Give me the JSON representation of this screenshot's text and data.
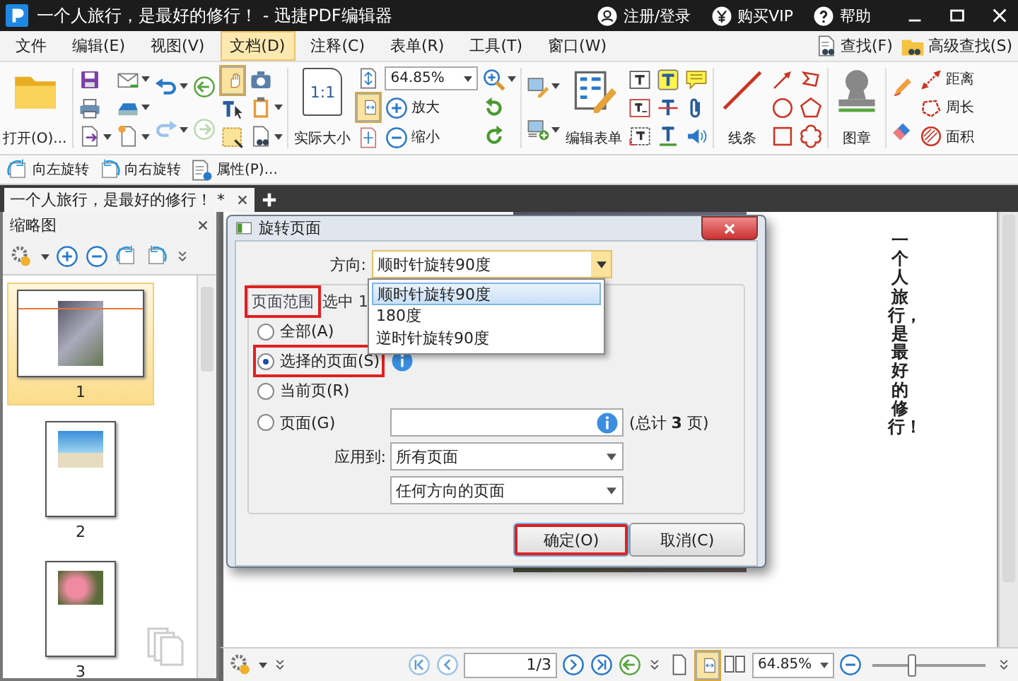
{
  "window": {
    "title": "一个人旅行，是最好的修行！ - 迅捷PDF编辑器",
    "actions": [
      {
        "kind": "user",
        "label": "注册/登录"
      },
      {
        "kind": "vip",
        "label": "购买VIP"
      },
      {
        "kind": "help",
        "label": "帮助"
      }
    ]
  },
  "menu": [
    {
      "label": "文件",
      "selected": false
    },
    {
      "label": "编辑(E)",
      "selected": false
    },
    {
      "label": "视图(V)",
      "selected": false
    },
    {
      "label": "文档(D)",
      "selected": true
    },
    {
      "label": "注释(C)",
      "selected": false
    },
    {
      "label": "表单(R)",
      "selected": false
    },
    {
      "label": "工具(T)",
      "selected": false
    },
    {
      "label": "窗口(W)",
      "selected": false
    }
  ],
  "search_buttons": [
    {
      "kind": "find",
      "label": "查找(F)"
    },
    {
      "kind": "advanced",
      "label": "高级查找(S)"
    }
  ],
  "ribbon": {
    "open": "打开(O)...",
    "actual_size": "实际大小",
    "actual_size_badge": "1:1",
    "tools": [
      {
        "kind": "hand",
        "selected": true
      },
      {
        "kind": "text-select",
        "selected": false
      },
      {
        "kind": "area-select",
        "selected": false
      }
    ],
    "fit_modes": [
      {
        "kind": "fit-page",
        "selected": false
      },
      {
        "kind": "fit-width",
        "selected": true
      },
      {
        "kind": "fit-visible",
        "selected": false
      }
    ],
    "zoom": "64.85%",
    "zoom_in": "放大",
    "zoom_out": "缩小",
    "edit_form": "编辑表单",
    "lines": "线条",
    "stamp": "图章",
    "measure": [
      {
        "kind": "distance",
        "label": "距离"
      },
      {
        "kind": "perimeter",
        "label": "周长"
      },
      {
        "kind": "area",
        "label": "面积"
      }
    ]
  },
  "quick_bar": [
    {
      "kind": "rotate-left",
      "label": "向左旋转"
    },
    {
      "kind": "rotate-right",
      "label": "向右旋转"
    },
    {
      "kind": "properties",
      "label": "属性(P)..."
    }
  ],
  "document_tab": {
    "title": "一个人旅行，是最好的修行！ *"
  },
  "thumbnails": {
    "title": "缩略图",
    "pages": [
      {
        "number": "1",
        "kind": "landscape",
        "selected": true
      },
      {
        "number": "2",
        "kind": "beach",
        "selected": false
      },
      {
        "number": "3",
        "kind": "flowers",
        "selected": false
      }
    ]
  },
  "page_text": "一个人旅行，是最好的修行！",
  "dialog": {
    "title": "旋转页面",
    "direction_label": "方向:",
    "direction": "顺时针旋转90度",
    "direction_options": [
      {
        "label": "顺时针旋转90度",
        "selected": true
      },
      {
        "label": "180度",
        "selected": false
      },
      {
        "label": "逆时针旋转90度",
        "selected": false
      }
    ],
    "range_title": "页面范围",
    "range_title_marked": true,
    "range_note": "选中 1",
    "ranges": [
      {
        "label": "全部(A)",
        "selected": false
      },
      {
        "label": "选择的页面(S)",
        "selected": true,
        "marked": true
      },
      {
        "label": "当前页(R)",
        "selected": false
      },
      {
        "label": "页面(G)",
        "selected": false
      }
    ],
    "total": "(总计 **3** 页)",
    "apply_label": "应用到:",
    "apply_pages": "所有页面",
    "apply_orientation": "任何方向的页面",
    "buttons": [
      {
        "label": "确定(O)",
        "marked": true
      },
      {
        "label": "取消(C)",
        "marked": false
      }
    ]
  },
  "status_bar": {
    "page": "1/3",
    "zoom": "64.85%",
    "zoom_slider": {
      "level": 0.35
    },
    "views": [
      {
        "kind": "single",
        "selected": false
      },
      {
        "kind": "fit-width",
        "selected": true
      },
      {
        "kind": "facing",
        "selected": false
      }
    ]
  }
}
